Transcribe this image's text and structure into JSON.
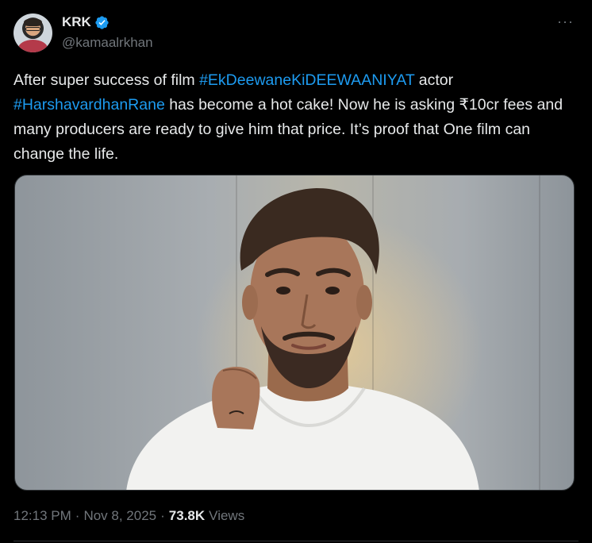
{
  "author": {
    "name": "KRK",
    "handle": "@kamaalrkhan",
    "verified": true,
    "verified_color": "#1d9bf0"
  },
  "menu": {
    "icon": "more-icon",
    "glyph": "···"
  },
  "tweet": {
    "part1": "After super success of film ",
    "hashtag1": "#EkDeewaneKiDEEWAANIYAT",
    "part2": " actor ",
    "hashtag2": "#HarshavardhanRane",
    "part3": " has become a hot cake! Now he is asking ₹10cr fees and many producers are ready to give him that price. It’s proof that One film can change the life.",
    "hashtag_color": "#1d9bf0"
  },
  "meta": {
    "time": "12:13 PM",
    "sep1": "·",
    "date": "Nov 8, 2025",
    "sep2": "·",
    "views_count": "73.8K",
    "views_label": "Views"
  },
  "colors": {
    "background": "#000000",
    "text": "#e7e9ea",
    "muted": "#71767b",
    "link": "#1d9bf0"
  }
}
